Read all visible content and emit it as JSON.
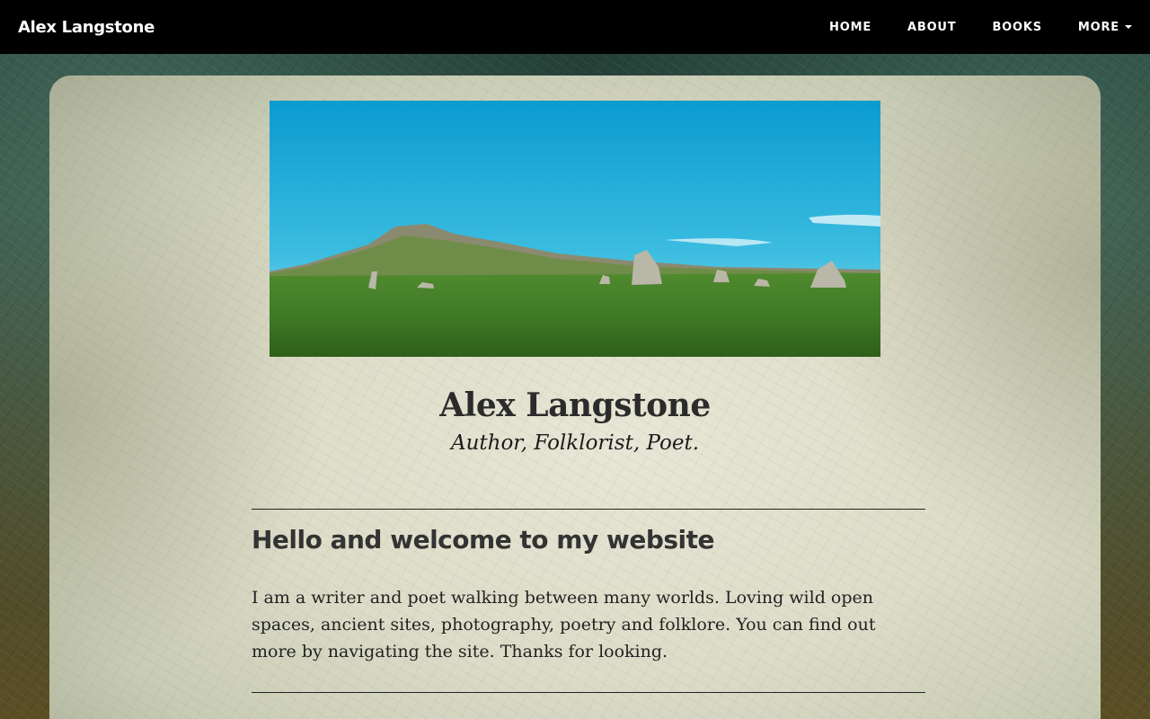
{
  "navbar": {
    "brand": "Alex Langstone",
    "links": [
      {
        "label": "HOME"
      },
      {
        "label": "ABOUT"
      },
      {
        "label": "BOOKS"
      },
      {
        "label": "MORE",
        "has_dropdown": true
      }
    ]
  },
  "hero": {
    "title": "Alex Langstone",
    "subtitle": "Author, Folklorist, Poet.",
    "image_icon": "landscape-photo"
  },
  "main": {
    "heading": "Hello and welcome to my website",
    "body": "I am a writer and poet walking between many worlds. Loving wild open spaces, ancient sites, photography, poetry and folklore. You can find out more by navigating the site. Thanks for looking."
  },
  "colors": {
    "navbar_bg": "#000000",
    "nav_text": "#ffffff",
    "panel_bg": "#e2e1d0",
    "heading_text": "#333333"
  }
}
